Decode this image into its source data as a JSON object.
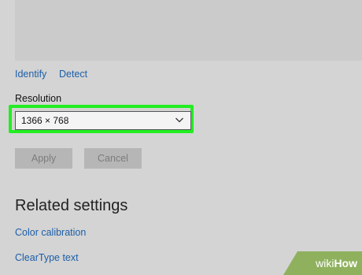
{
  "display": {
    "identify_label": "Identify",
    "detect_label": "Detect"
  },
  "resolution": {
    "label": "Resolution",
    "value": "1366 × 768"
  },
  "buttons": {
    "apply_label": "Apply",
    "cancel_label": "Cancel"
  },
  "related_settings": {
    "title": "Related settings",
    "links": [
      "Color calibration",
      "ClearType text"
    ]
  },
  "watermark": {
    "part1": "wiki",
    "part2": "How"
  },
  "colors": {
    "background": "#d4d4d4",
    "link": "#1c5ea8",
    "highlight": "#22ee22",
    "disabled_button": "#b6b6b6"
  },
  "icons": {
    "dropdown": "chevron-down-icon"
  }
}
